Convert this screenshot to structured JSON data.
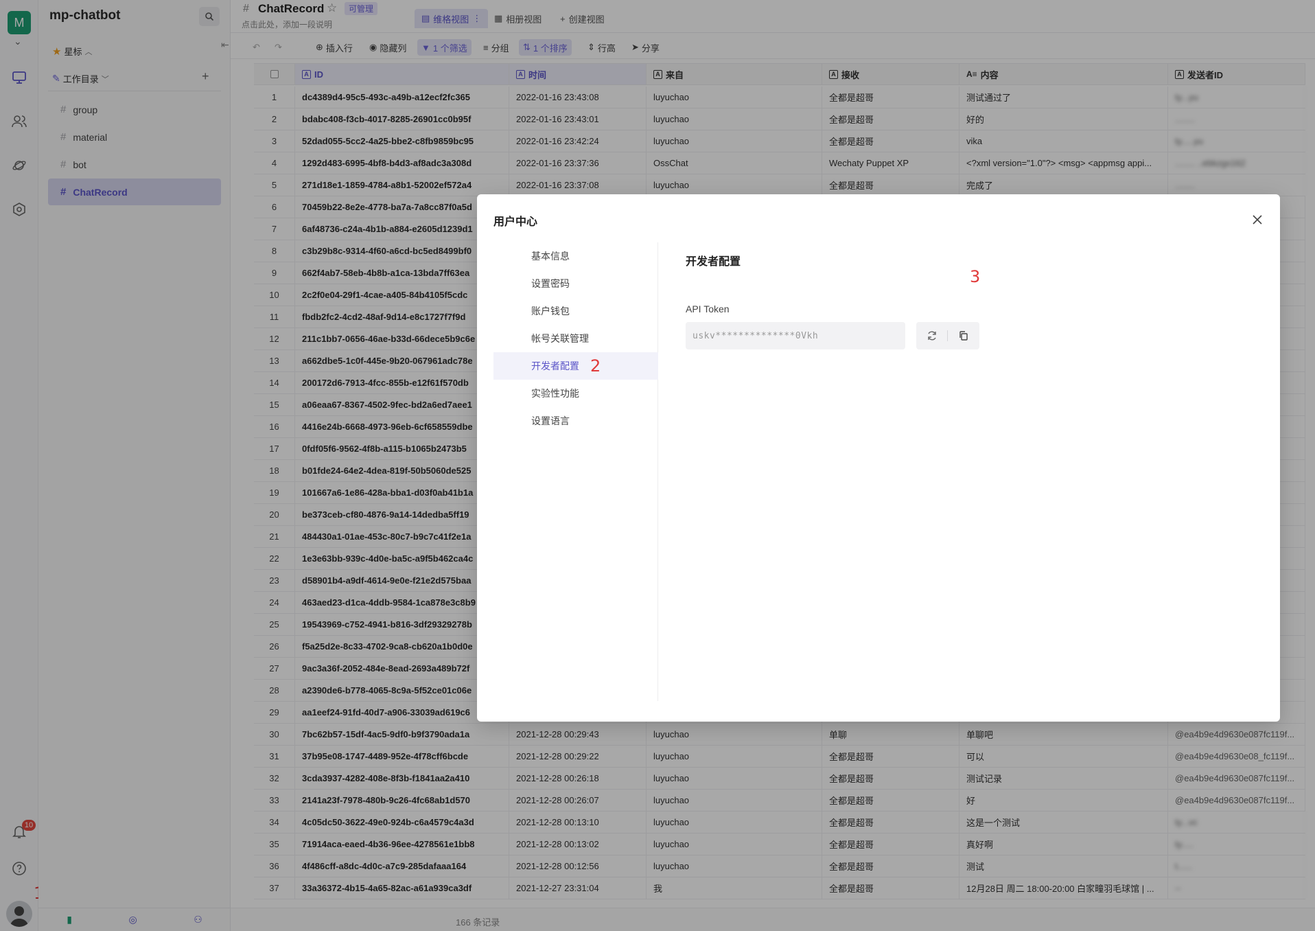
{
  "rail": {
    "logo_letter": "M",
    "notification_count": "10",
    "step_marker": "1"
  },
  "sidebar": {
    "title": "mp-chatbot",
    "starred_label": "星标",
    "workspace_label": "工作目录",
    "items": [
      {
        "label": "group"
      },
      {
        "label": "material"
      },
      {
        "label": "bot"
      },
      {
        "label": "ChatRecord"
      }
    ]
  },
  "header": {
    "datasheet_name": "ChatRecord",
    "permission_badge": "可管理",
    "description_placeholder": "点击此处，添加一段说明",
    "views": [
      {
        "label": "维格视图"
      },
      {
        "label": "相册视图"
      },
      {
        "label": "创建视图"
      }
    ]
  },
  "toolbar": {
    "insert_row": "插入行",
    "hide_columns": "隐藏列",
    "filter": "1 个筛选",
    "group": "分组",
    "sort": "1 个排序",
    "row_height": "行高",
    "share": "分享"
  },
  "table": {
    "columns": [
      {
        "label": "ID"
      },
      {
        "label": "时间"
      },
      {
        "label": "来自"
      },
      {
        "label": "接收"
      },
      {
        "label": "内容"
      },
      {
        "label": "发送者ID"
      }
    ],
    "rows": [
      {
        "n": "1",
        "id": "dc4389d4-95c5-493c-a49b-a12ecf2fc365",
        "time": "2022-01-16 23:43:08",
        "from": "luyuchao",
        "to": "全都是超哥",
        "content": "测试通过了",
        "sender": "ty...yu"
      },
      {
        "n": "2",
        "id": "bdabc408-f3cb-4017-8285-26901cc0b95f",
        "time": "2022-01-16 23:43:01",
        "from": "luyuchao",
        "to": "全都是超哥",
        "content": "好的",
        "sender": "........"
      },
      {
        "n": "3",
        "id": "52dad055-5cc2-4a25-bbe2-c8fb9859bc95",
        "time": "2022-01-16 23:42:24",
        "from": "luyuchao",
        "to": "全都是超哥",
        "content": "vika",
        "sender": "ty.....yu"
      },
      {
        "n": "4",
        "id": "1292d483-6995-4bf8-b4d3-af8adc3a308d",
        "time": "2022-01-16 23:37:36",
        "from": "OssChat",
        "to": "Wechaty Puppet XP",
        "content": "<?xml version=\"1.0\"?> <msg> <appmsg appi...",
        "sender": "........ ..ebkzgx162"
      },
      {
        "n": "5",
        "id": "271d18e1-1859-4784-a8b1-52002ef572a4",
        "time": "2022-01-16 23:37:08",
        "from": "luyuchao",
        "to": "全都是超哥",
        "content": "完成了",
        "sender": "........"
      },
      {
        "n": "6",
        "id": "70459b22-8e2e-4778-ba7a-7a8cc87f0a5d"
      },
      {
        "n": "7",
        "id": "6af48736-c24a-4b1b-a884-e2605d1239d1"
      },
      {
        "n": "8",
        "id": "c3b29b8c-9314-4f60-a6cd-bc5ed8499bf0"
      },
      {
        "n": "9",
        "id": "662f4ab7-58eb-4b8b-a1ca-13bda7ff63ea"
      },
      {
        "n": "10",
        "id": "2c2f0e04-29f1-4cae-a405-84b4105f5cdc"
      },
      {
        "n": "11",
        "id": "fbdb2fc2-4cd2-48af-9d14-e8c1727f7f9d"
      },
      {
        "n": "12",
        "id": "211c1bb7-0656-46ae-b33d-66dece5b9c6e"
      },
      {
        "n": "13",
        "id": "a662dbe5-1c0f-445e-9b20-067961adc78e"
      },
      {
        "n": "14",
        "id": "200172d6-7913-4fcc-855b-e12f61f570db"
      },
      {
        "n": "15",
        "id": "a06eaa67-8367-4502-9fec-bd2a6ed7aee1"
      },
      {
        "n": "16",
        "id": "4416e24b-6668-4973-96eb-6cf658559dbe"
      },
      {
        "n": "17",
        "id": "0fdf05f6-9562-4f8b-a115-b1065b2473b5"
      },
      {
        "n": "18",
        "id": "b01fde24-64e2-4dea-819f-50b5060de525"
      },
      {
        "n": "19",
        "id": "101667a6-1e86-428a-bba1-d03f0ab41b1a"
      },
      {
        "n": "20",
        "id": "be373ceb-cf80-4876-9a14-14dedba5ff19"
      },
      {
        "n": "21",
        "id": "484430a1-01ae-453c-80c7-b9c7c41f2e1a"
      },
      {
        "n": "22",
        "id": "1e3e63bb-939c-4d0e-ba5c-a9f5b462ca4c"
      },
      {
        "n": "23",
        "id": "d58901b4-a9df-4614-9e0e-f21e2d575baa"
      },
      {
        "n": "24",
        "id": "463aed23-d1ca-4ddb-9584-1ca878e3c8b9"
      },
      {
        "n": "25",
        "id": "19543969-c752-4941-b816-3df29329278b"
      },
      {
        "n": "26",
        "id": "f5a25d2e-8c33-4702-9ca8-cb620a1b0d0e"
      },
      {
        "n": "27",
        "id": "9ac3a36f-2052-484e-8ead-2693a489b72f"
      },
      {
        "n": "28",
        "id": "a2390de6-b778-4065-8c9a-5f52ce01c06e"
      },
      {
        "n": "29",
        "id": "aa1eef24-91fd-40d7-a906-33039ad619c6"
      },
      {
        "n": "30",
        "id": "7bc62b57-15df-4ac5-9df0-b9f3790ada1a",
        "time": "2021-12-28 00:29:43",
        "from": "luyuchao",
        "to": "单聊",
        "content": "单聊吧",
        "sender": "@ea4b9e4d9630e087fc119f..."
      },
      {
        "n": "31",
        "id": "37b95e08-1747-4489-952e-4f78cff6bcde",
        "time": "2021-12-28 00:29:22",
        "from": "luyuchao",
        "to": "全都是超哥",
        "content": "可以",
        "sender": "@ea4b9e4d9630e08_fc119f..."
      },
      {
        "n": "32",
        "id": "3cda3937-4282-408e-8f3b-f1841aa2a410",
        "time": "2021-12-28 00:26:18",
        "from": "luyuchao",
        "to": "全都是超哥",
        "content": "测试记录",
        "sender": "@ea4b9e4d9630e087fc119f..."
      },
      {
        "n": "33",
        "id": "2141a23f-7978-480b-9c26-4fc68ab1d570",
        "time": "2021-12-28 00:26:07",
        "from": "luyuchao",
        "to": "全都是超哥",
        "content": "好",
        "sender": "@ea4b9e4d9630e087fc119f..."
      },
      {
        "n": "34",
        "id": "4c05dc50-3622-49e0-924b-c6a4579c4a3d",
        "time": "2021-12-28 00:13:10",
        "from": "luyuchao",
        "to": "全都是超哥",
        "content": "这是一个测试",
        "sender": "ty...vc"
      },
      {
        "n": "35",
        "id": "71914aca-eaed-4b36-96ee-4278561e1bb8",
        "time": "2021-12-28 00:13:02",
        "from": "luyuchao",
        "to": "全都是超哥",
        "content": "真好啊",
        "sender": "ty....."
      },
      {
        "n": "36",
        "id": "4f486cff-a8dc-4d0c-a7c9-285dafaaa164",
        "time": "2021-12-28 00:12:56",
        "from": "luyuchao",
        "to": "全都是超哥",
        "content": "测试",
        "sender": "t......"
      },
      {
        "n": "37",
        "id": "33a36372-4b15-4a65-82ac-a61a939ca3df",
        "time": "2021-12-27 23:31:04",
        "from": "我",
        "to": "全都是超哥",
        "content": "12月28日 周二 18:00-20:00 白家疃羽毛球馆 | ...",
        "sender": "--"
      }
    ],
    "record_count": "166 条记录"
  },
  "modal": {
    "title": "用户中心",
    "nav": [
      {
        "label": "基本信息"
      },
      {
        "label": "设置密码"
      },
      {
        "label": "账户钱包"
      },
      {
        "label": "帐号关联管理"
      },
      {
        "label": "开发者配置"
      },
      {
        "label": "实验性功能"
      },
      {
        "label": "设置语言"
      }
    ],
    "active_nav": "开发者配置",
    "section_title": "开发者配置",
    "api_token_label": "API Token",
    "api_token_value": "uskv**************0Vkh",
    "step_marker_2": "2",
    "step_marker_3": "3"
  },
  "colors": {
    "accent": "#5b55c8",
    "logo_bg": "#1e9d73",
    "annotation_red": "#e03a3a",
    "badge_red": "#e3463f"
  }
}
